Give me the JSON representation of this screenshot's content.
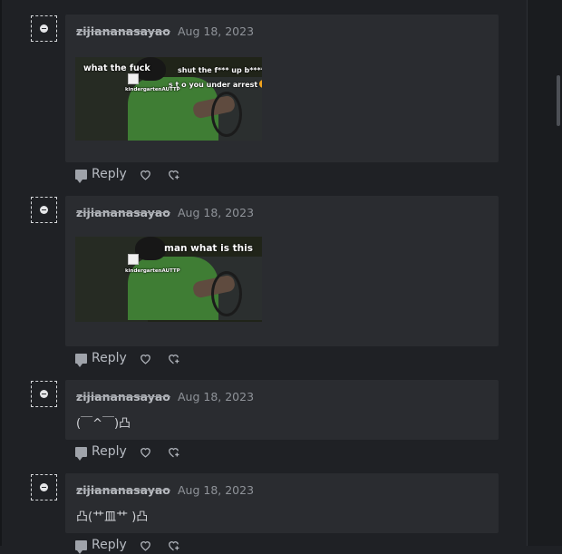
{
  "comments": [
    {
      "author": "zijiananasayao",
      "date": "Aug 18, 2023",
      "media": {
        "overlays": {
          "left": "what the fuck",
          "right": "shut the f*** up b****",
          "right2": "s t o you under arrest",
          "watermark": "kindergartenAUTTP"
        }
      },
      "actions": {
        "reply": "Reply"
      }
    },
    {
      "author": "zijiananasayao",
      "date": "Aug 18, 2023",
      "media": {
        "overlays": {
          "right": "man what is this",
          "watermark": "kindergartenAUTTP"
        }
      },
      "actions": {
        "reply": "Reply"
      }
    },
    {
      "author": "zijiananasayao",
      "date": "Aug 18, 2023",
      "text": "(￣^￣)凸",
      "actions": {
        "reply": "Reply"
      }
    },
    {
      "author": "zijiananasayao",
      "date": "Aug 18, 2023",
      "text": "凸(艹皿艹 )凸",
      "actions": {
        "reply": "Reply"
      }
    }
  ],
  "icons": {
    "avatar": "avatar-placeholder-icon",
    "reply": "comment-bubble-icon",
    "like": "heart-icon",
    "react": "react-heart-plus-icon"
  },
  "colors": {
    "page_background": "#1f2125",
    "card_background": "#2a2c30",
    "muted_text": "#8f9399"
  }
}
